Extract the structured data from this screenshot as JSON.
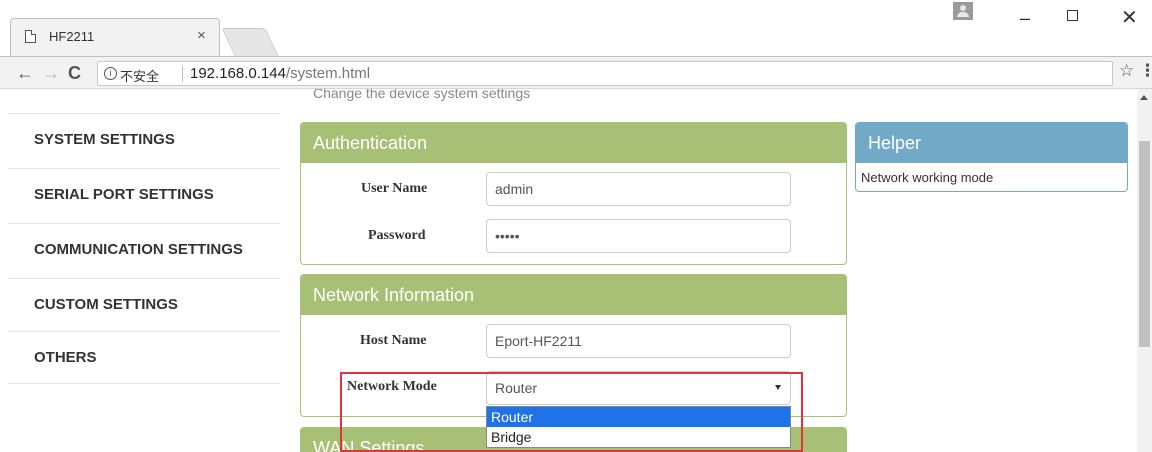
{
  "browser": {
    "tab_title": "HF2211",
    "tab_close": "×",
    "security_label": "不安全",
    "url_host": "192.168.0.144",
    "url_path": "/system.html",
    "icons": [
      "page-icon",
      "close-icon",
      "back-icon",
      "forward-icon",
      "reload-icon",
      "info-icon",
      "star-icon",
      "menu-icon",
      "user-icon",
      "minimize-icon",
      "maximize-icon"
    ]
  },
  "page": {
    "subtitle": "Change the device system settings"
  },
  "sidebar": {
    "items": [
      {
        "label": "SYSTEM SETTINGS"
      },
      {
        "label": "SERIAL PORT SETTINGS"
      },
      {
        "label": "COMMUNICATION SETTINGS"
      },
      {
        "label": "CUSTOM SETTINGS"
      },
      {
        "label": "OTHERS"
      }
    ]
  },
  "auth": {
    "title": "Authentication",
    "username_label": "User Name",
    "username_value": "admin",
    "password_label": "Password",
    "password_value": "•••••"
  },
  "network": {
    "title": "Network Information",
    "hostname_label": "Host Name",
    "hostname_value": "Eport-HF2211",
    "mode_label": "Network Mode",
    "mode_value": "Router",
    "mode_options": [
      "Router",
      "Bridge"
    ],
    "mode_selected_index": 0
  },
  "wan": {
    "title": "WAN Settings"
  },
  "helper": {
    "title": "Helper",
    "text": "Network working mode"
  },
  "colors": {
    "panel_green": "#a8bf76",
    "helper_blue": "#71a9c7",
    "highlight_red": "#e0343b",
    "selection_blue": "#1e73e8"
  }
}
